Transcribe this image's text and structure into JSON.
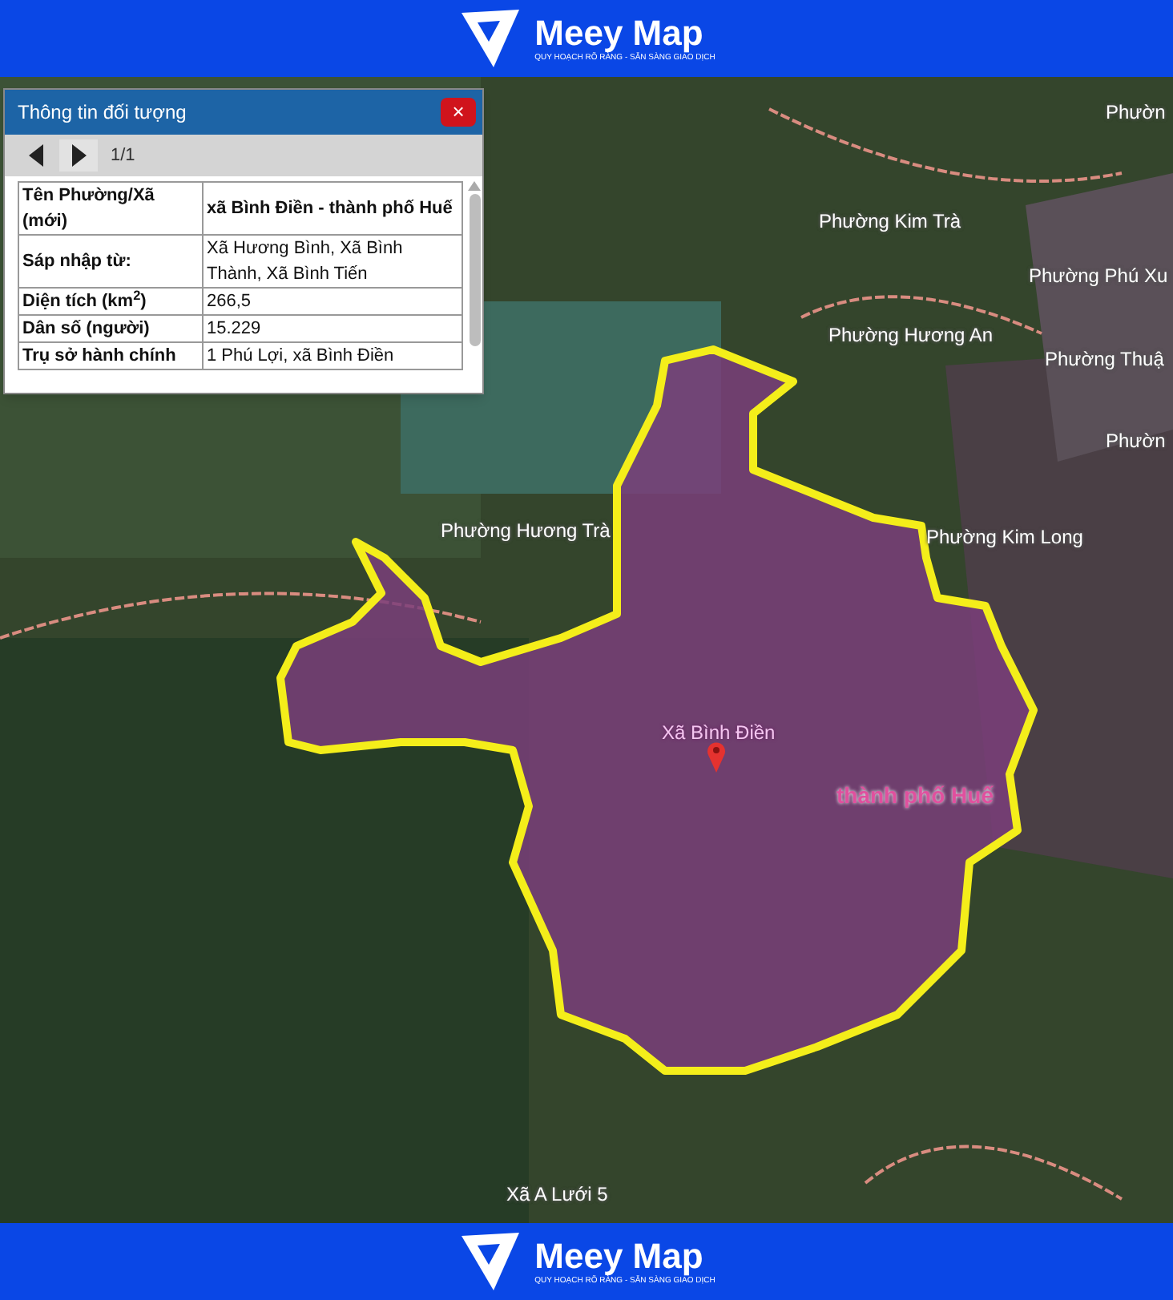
{
  "header": {
    "brand": "Meey Map",
    "tagline": "QUY HOẠCH RÕ RÀNG - SẴN SÀNG GIAO DỊCH"
  },
  "popup": {
    "title": "Thông tin đối tượng",
    "close": "×",
    "pager": "1/1",
    "rows": [
      {
        "label": "Tên Phường/Xã (mới)",
        "value": "xã Bình Điền - thành phố Huế",
        "bold": true
      },
      {
        "label": "Sáp nhập từ:",
        "value": "Xã Hương Bình, Xã Bình Thành, Xã Bình Tiến",
        "bold": false
      },
      {
        "label": "Diện tích (km$^{2}$)",
        "value": "266,5",
        "bold": false
      },
      {
        "label": "Dân số (người)",
        "value": "15.229",
        "bold": false
      },
      {
        "label": "Trụ sở hành chính",
        "value": "1 Phú Lợi, xã Bình Điền",
        "bold": false
      }
    ]
  },
  "map": {
    "labels": [
      {
        "text": "Phườn",
        "kind": "ward"
      },
      {
        "text": "Phường Kim Trà",
        "kind": "ward"
      },
      {
        "text": "Phường Phú Xu",
        "kind": "ward"
      },
      {
        "text": "Phường Hương An",
        "kind": "ward"
      },
      {
        "text": "Phường Thuậ",
        "kind": "ward"
      },
      {
        "text": "Phườn",
        "kind": "ward"
      },
      {
        "text": "Phường Hương Trà",
        "kind": "ward"
      },
      {
        "text": "Phường Kim Long",
        "kind": "ward"
      },
      {
        "text": "Xã Bình Điền",
        "kind": "selected"
      },
      {
        "text": "thành phố Huế",
        "kind": "city"
      },
      {
        "text": "Xã A Lưới 5",
        "kind": "ward"
      }
    ]
  },
  "footer": {
    "brand": "Meey Map",
    "tagline": "QUY HOẠCH RÕ RÀNG - SẴN SÀNG GIAO DỊCH"
  }
}
